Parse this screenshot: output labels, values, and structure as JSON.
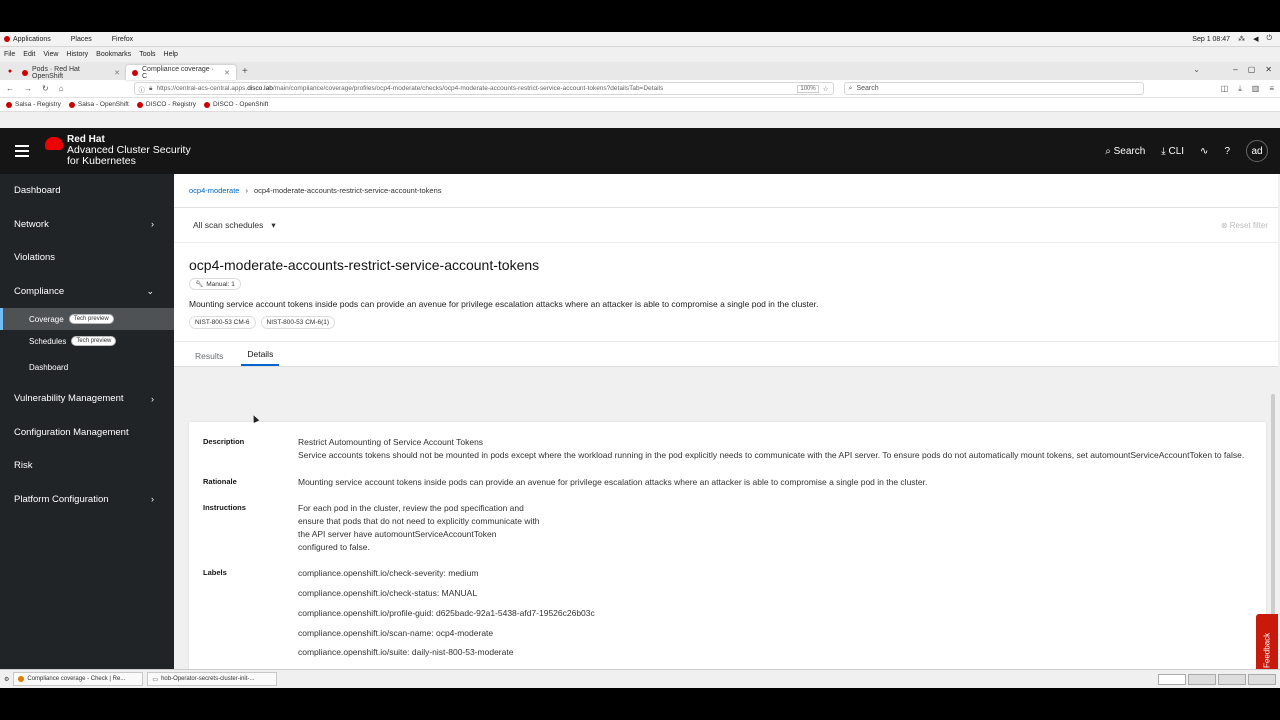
{
  "gnome": {
    "applications": "Applications",
    "places": "Places",
    "firefox": "Firefox",
    "datetime": "Sep 1 08:47"
  },
  "firefox_menu": [
    "File",
    "Edit",
    "View",
    "History",
    "Bookmarks",
    "Tools",
    "Help"
  ],
  "tabs": [
    {
      "label": "Pods · Red Hat OpenShift"
    },
    {
      "label": "Compliance coverage · C"
    }
  ],
  "url": {
    "prefix": "https://central-acs-central.apps.",
    "host": "disco.lab",
    "rest": "/main/compliance/coverage/profiles/ocp4-moderate/checks/ocp4-moderate-accounts-restrict-service-account-tokens?detailsTab=Details",
    "zoom": "100%"
  },
  "search_placeholder": "Search",
  "bookmarks": [
    "Salsa - Registry",
    "Salsa - OpenShift",
    "DISCO - Registry",
    "DISCO - OpenShift"
  ],
  "masthead": {
    "brand_top": "Red Hat",
    "product_line1": "Advanced Cluster Security",
    "product_line2": "for Kubernetes",
    "search": "Search",
    "cli": "CLI",
    "avatar": "ad"
  },
  "sidebar": {
    "dashboard": "Dashboard",
    "network": "Network",
    "violations": "Violations",
    "compliance": "Compliance",
    "coverage": "Coverage",
    "schedules": "Schedules",
    "tech_preview": "Tech preview",
    "compliance_dashboard": "Dashboard",
    "vulnerability": "Vulnerability Management",
    "configuration": "Configuration Management",
    "risk": "Risk",
    "platform": "Platform Configuration"
  },
  "breadcrumb": {
    "parent": "ocp4-moderate",
    "current": "ocp4-moderate-accounts-restrict-service-account-tokens"
  },
  "filter": {
    "schedule_select": "All scan schedules",
    "reset": "Reset filter"
  },
  "check": {
    "title": "ocp4-moderate-accounts-restrict-service-account-tokens",
    "status_badge": "Manual: 1",
    "description": "Mounting service account tokens inside pods can provide an avenue for privilege escalation attacks where an attacker is able to compromise a single pod in the cluster.",
    "controls": [
      "NIST-800-53 CM-6",
      "NIST-800-53 CM-6(1)"
    ]
  },
  "detail_tabs": [
    "Results",
    "Details"
  ],
  "details": {
    "description_label": "Description",
    "description_title": "Restrict Automounting of Service Account Tokens",
    "description_body": "Service accounts tokens should not be mounted in pods except where the workload running in the pod explicitly needs to communicate with the API server. To ensure pods do not automatically mount tokens, set automountServiceAccountToken to false.",
    "rationale_label": "Rationale",
    "rationale": "Mounting service account tokens inside pods can provide an avenue for privilege escalation attacks where an attacker is able to compromise a single pod in the cluster.",
    "instructions_label": "Instructions",
    "instructions": [
      "For each pod in the cluster, review the pod specification and",
      "ensure that pods that do not need to explicitly communicate with",
      "the API server have automountServiceAccountToken",
      "configured to false."
    ],
    "labels_label": "Labels",
    "labels": [
      "compliance.openshift.io/check-severity: medium",
      "compliance.openshift.io/check-status: MANUAL",
      "compliance.openshift.io/profile-guid: d625badc-92a1-5438-afd7-19526c26b03c",
      "compliance.openshift.io/scan-name: ocp4-moderate",
      "compliance.openshift.io/suite: daily-nist-800-53-moderate"
    ]
  },
  "feedback": "Feedback",
  "taskbar": [
    "Compliance coverage - Check | Re...",
    "hob-Operator-secrets-cluster-init-..."
  ]
}
